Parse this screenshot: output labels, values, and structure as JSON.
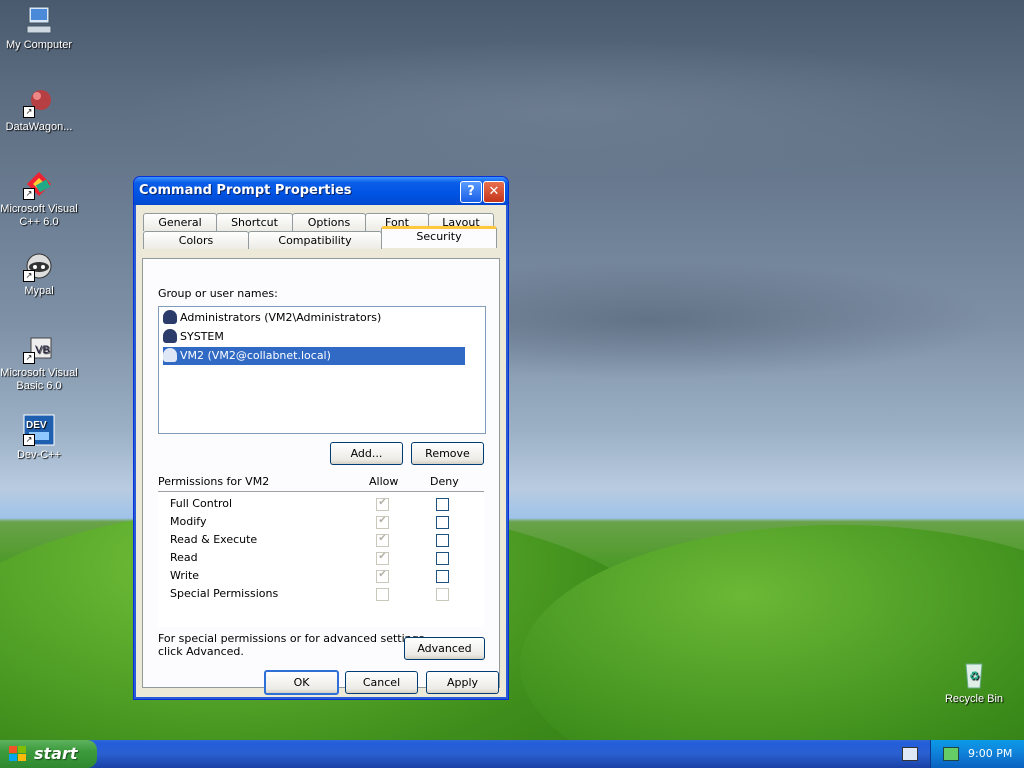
{
  "desktop": {
    "icons": [
      {
        "label": "My Computer"
      },
      {
        "label": "DataWagon..."
      },
      {
        "label": "Microsoft Visual C++ 6.0"
      },
      {
        "label": "Mypal"
      },
      {
        "label": "Microsoft Visual Basic 6.0"
      },
      {
        "label": "Dev-C++"
      },
      {
        "label": "Recycle Bin"
      }
    ]
  },
  "dialog": {
    "title": "Command Prompt Properties",
    "help_glyph": "?",
    "close_glyph": "✕",
    "tabs_row1": [
      "General",
      "Shortcut",
      "Options",
      "Font",
      "Layout"
    ],
    "tabs_row2": [
      "Colors",
      "Compatibility",
      "Security"
    ],
    "active_tab": "Security",
    "group_label": "Group or user names:",
    "users": [
      {
        "name": "Administrators (VM2\\Administrators)",
        "selected": false
      },
      {
        "name": "SYSTEM",
        "selected": false
      },
      {
        "name": "VM2 (VM2@collabnet.local)",
        "selected": true
      }
    ],
    "add_label": "Add...",
    "remove_label": "Remove",
    "permissions_label": "Permissions for VM2",
    "allow_label": "Allow",
    "deny_label": "Deny",
    "permissions": [
      {
        "name": "Full Control",
        "allow": true,
        "deny": false
      },
      {
        "name": "Modify",
        "allow": true,
        "deny": false
      },
      {
        "name": "Read & Execute",
        "allow": true,
        "deny": false
      },
      {
        "name": "Read",
        "allow": true,
        "deny": false
      },
      {
        "name": "Write",
        "allow": true,
        "deny": false
      },
      {
        "name": "Special Permissions",
        "allow": false,
        "deny": false
      }
    ],
    "advanced_note_line1": "For special permissions or for advanced settings,",
    "advanced_note_line2": "click Advanced.",
    "advanced_label": "Advanced",
    "ok_label": "OK",
    "cancel_label": "Cancel",
    "apply_label": "Apply"
  },
  "taskbar": {
    "start_label": "start",
    "clock": "9:00 PM"
  }
}
